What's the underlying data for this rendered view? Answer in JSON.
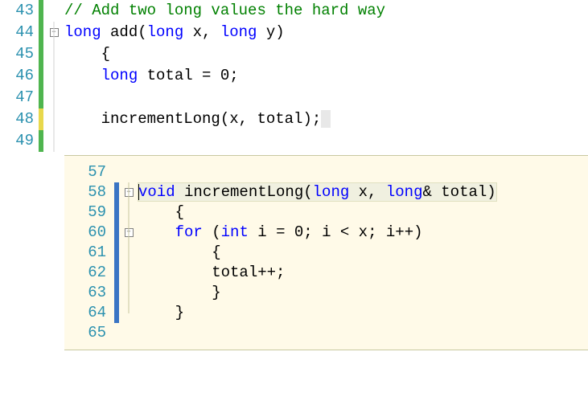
{
  "main": {
    "lines": [
      {
        "num": 43,
        "bar": "green",
        "fold": null,
        "tokens": [
          {
            "cls": "cm",
            "t": "// Add two long values the hard way"
          }
        ]
      },
      {
        "num": 44,
        "bar": "green",
        "fold": "minus",
        "tokens": [
          {
            "cls": "kw",
            "t": "long"
          },
          {
            "cls": "",
            "t": " add("
          },
          {
            "cls": "kw",
            "t": "long"
          },
          {
            "cls": "",
            "t": " x, "
          },
          {
            "cls": "kw",
            "t": "long"
          },
          {
            "cls": "",
            "t": " y)"
          }
        ]
      },
      {
        "num": 45,
        "bar": "green",
        "fold": "line",
        "tokens": [
          {
            "cls": "",
            "t": "    {"
          }
        ]
      },
      {
        "num": 46,
        "bar": "green",
        "fold": "line",
        "tokens": [
          {
            "cls": "",
            "t": "    "
          },
          {
            "cls": "kw",
            "t": "long"
          },
          {
            "cls": "",
            "t": " total = 0;"
          }
        ]
      },
      {
        "num": 47,
        "bar": "green",
        "fold": "line",
        "tokens": [
          {
            "cls": "",
            "t": ""
          }
        ]
      },
      {
        "num": 48,
        "bar": "yellow",
        "fold": "line",
        "tokens": [
          {
            "cls": "",
            "t": "    incrementLong(x, total);"
          }
        ],
        "highlight_after": true
      },
      {
        "num": 49,
        "bar": "green",
        "fold": "line",
        "tokens": [
          {
            "cls": "",
            "t": ""
          }
        ]
      }
    ]
  },
  "peek": {
    "lines": [
      {
        "num": 57,
        "bar": "",
        "fold": null,
        "tokens": [
          {
            "cls": "",
            "t": ""
          }
        ]
      },
      {
        "num": 58,
        "bar": "blue",
        "fold": "minus",
        "tokens": [
          {
            "cls": "kw",
            "t": "void"
          },
          {
            "cls": "",
            "t": " incrementLong("
          },
          {
            "cls": "kw",
            "t": "long"
          },
          {
            "cls": "",
            "t": " x, "
          },
          {
            "cls": "kw",
            "t": "long"
          },
          {
            "cls": "",
            "t": "& total)"
          }
        ],
        "caret_before": true,
        "selected": true
      },
      {
        "num": 59,
        "bar": "blue",
        "fold": "line",
        "tokens": [
          {
            "cls": "",
            "t": "    {"
          }
        ]
      },
      {
        "num": 60,
        "bar": "blue",
        "fold": "plus",
        "tokens": [
          {
            "cls": "",
            "t": "    "
          },
          {
            "cls": "kw",
            "t": "for"
          },
          {
            "cls": "",
            "t": " ("
          },
          {
            "cls": "kw",
            "t": "int"
          },
          {
            "cls": "",
            "t": " i = 0; i < x; i++)"
          }
        ]
      },
      {
        "num": 61,
        "bar": "blue",
        "fold": "line",
        "tokens": [
          {
            "cls": "",
            "t": "        {"
          }
        ]
      },
      {
        "num": 62,
        "bar": "blue",
        "fold": "line",
        "tokens": [
          {
            "cls": "",
            "t": "        total++;"
          }
        ]
      },
      {
        "num": 63,
        "bar": "blue",
        "fold": "line",
        "tokens": [
          {
            "cls": "",
            "t": "        }"
          }
        ]
      },
      {
        "num": 64,
        "bar": "blue",
        "fold": "end",
        "tokens": [
          {
            "cls": "",
            "t": "    }"
          }
        ]
      },
      {
        "num": 65,
        "bar": "",
        "fold": null,
        "tokens": [
          {
            "cls": "",
            "t": ""
          }
        ]
      }
    ]
  },
  "fold_glyph": {
    "minus": "−",
    "plus": "+"
  }
}
